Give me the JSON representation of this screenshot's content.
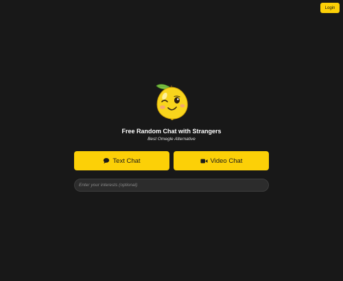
{
  "header": {
    "login_label": "Login"
  },
  "hero": {
    "mascot_icon": "winking-lemon-mascot-icon",
    "title": "Free Random Chat with Strangers",
    "subtitle": "Best Omegle Alternative"
  },
  "actions": {
    "text_chat_label": "Text Chat",
    "text_chat_icon": "speech-bubble-icon",
    "video_chat_label": "Video Chat",
    "video_chat_icon": "video-camera-icon"
  },
  "interests": {
    "value": "",
    "placeholder": "Enter your interests (optional)"
  },
  "colors": {
    "background": "#181818",
    "accent": "#fcd007",
    "input_background": "#2c2c2c"
  }
}
